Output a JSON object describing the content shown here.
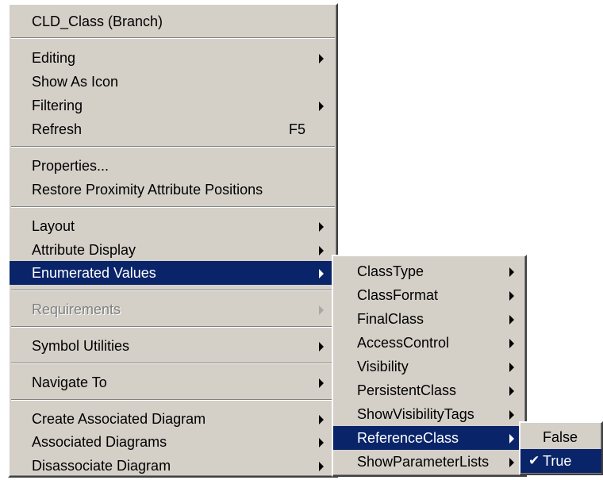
{
  "main_menu": {
    "title": "CLD_Class (Branch)",
    "editing": "Editing",
    "show_as_icon": "Show As Icon",
    "filtering": "Filtering",
    "refresh": "Refresh",
    "refresh_shortcut": "F5",
    "properties": "Properties...",
    "restore_positions": "Restore Proximity Attribute Positions",
    "layout": "Layout",
    "attribute_display": "Attribute Display",
    "enumerated_values": "Enumerated Values",
    "requirements": "Requirements",
    "symbol_utilities": "Symbol Utilities",
    "navigate_to": "Navigate To",
    "create_associated_diagram": "Create Associated Diagram",
    "associated_diagrams": "Associated Diagrams",
    "disassociate_diagram": "Disassociate Diagram"
  },
  "enumerated_values_menu": {
    "items": [
      "ClassType",
      "ClassFormat",
      "FinalClass",
      "AccessControl",
      "Visibility",
      "PersistentClass",
      "ShowVisibilityTags",
      "ReferenceClass",
      "ShowParameterLists"
    ]
  },
  "reference_class_menu": {
    "false_label": "False",
    "true_label": "True",
    "checkmark": "✔"
  },
  "colors": {
    "menu_bg": "#d4d0c8",
    "highlight": "#0a246a",
    "disabled_text": "#808080"
  }
}
